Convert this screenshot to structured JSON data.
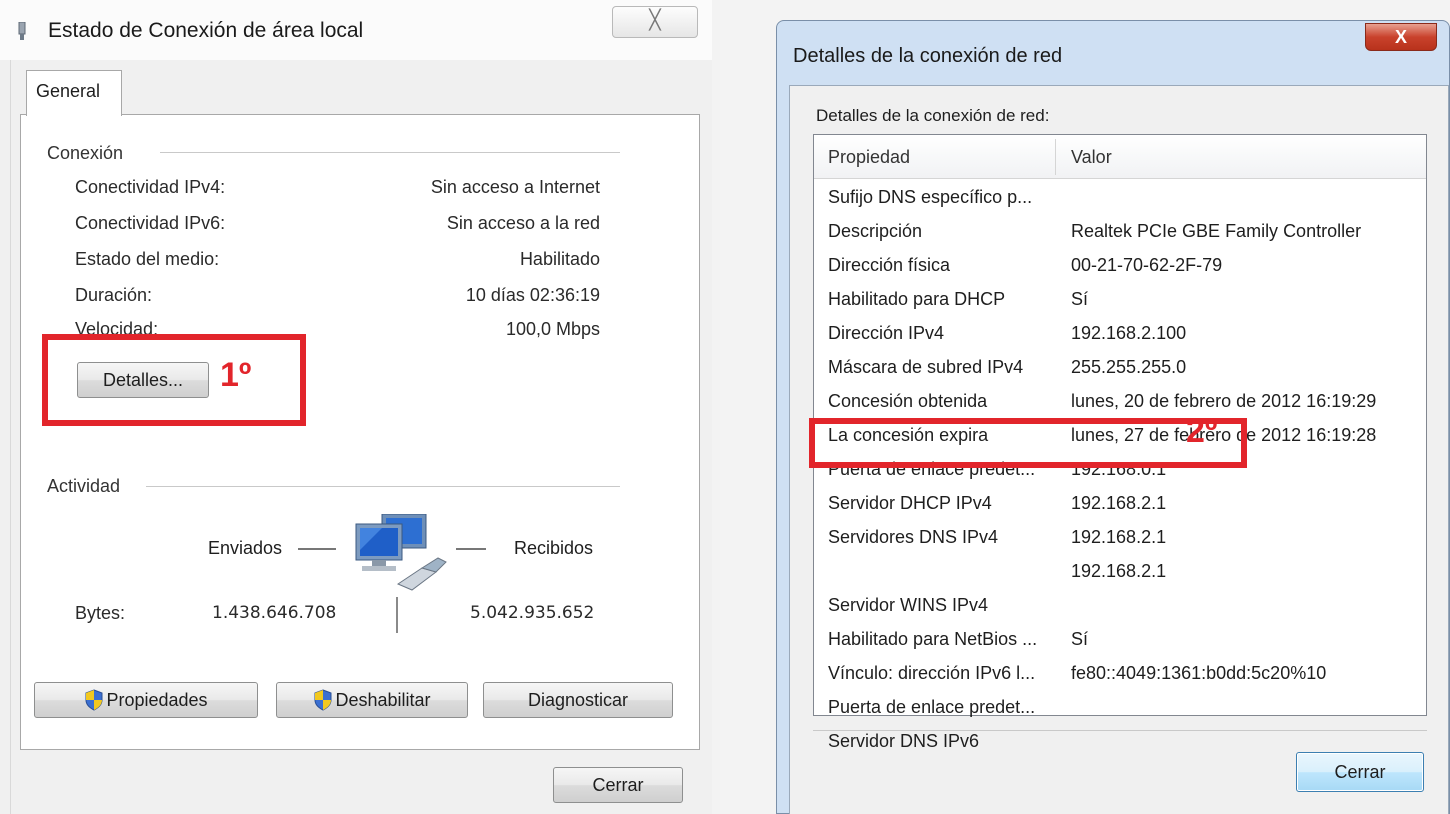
{
  "left_window": {
    "title": "Estado de Conexión de área local",
    "close_glyph": "╳",
    "tab": "General",
    "connection": {
      "group": "Conexión",
      "rows": [
        {
          "label": "Conectividad IPv4:",
          "value": "Sin acceso a Internet"
        },
        {
          "label": "Conectividad IPv6:",
          "value": "Sin acceso a la red"
        },
        {
          "label": "Estado del medio:",
          "value": "Habilitado"
        },
        {
          "label": "Duración:",
          "value": "10 días 02:36:19"
        },
        {
          "label": "Velocidad:",
          "value": "100,0 Mbps"
        }
      ],
      "details_button": "Detalles...",
      "mark": "1º"
    },
    "activity": {
      "group": "Actividad",
      "sent_label": "Enviados",
      "received_label": "Recibidos",
      "bytes_label": "Bytes:",
      "bytes_sent": "1.438.646.708",
      "bytes_received": "5.042.935.652"
    },
    "buttons": {
      "properties": "Propiedades",
      "disable": "Deshabilitar",
      "diagnose": "Diagnosticar",
      "close": "Cerrar"
    }
  },
  "right_window": {
    "title": "Detalles de la conexión de red",
    "close_glyph": "X",
    "caption": "Detalles de la conexión de red:",
    "columns": {
      "property": "Propiedad",
      "value": "Valor"
    },
    "rows": [
      {
        "property": "Sufijo DNS específico p...",
        "value": ""
      },
      {
        "property": "Descripción",
        "value": "Realtek PCIe GBE Family Controller"
      },
      {
        "property": "Dirección física",
        "value": "00-21-70-62-2F-79"
      },
      {
        "property": "Habilitado para DHCP",
        "value": "Sí"
      },
      {
        "property": "Dirección IPv4",
        "value": "192.168.2.100"
      },
      {
        "property": "Máscara de subred IPv4",
        "value": "255.255.255.0"
      },
      {
        "property": "Concesión obtenida",
        "value": "lunes, 20 de febrero de 2012 16:19:29"
      },
      {
        "property": "La concesión expira",
        "value": "lunes, 27 de febrero de 2012 16:19:28"
      },
      {
        "property": "Puerta de enlace predet...",
        "value": "192.168.0.1"
      },
      {
        "property": "Servidor DHCP IPv4",
        "value": "192.168.2.1"
      },
      {
        "property": "Servidores DNS IPv4",
        "value": "192.168.2.1"
      },
      {
        "property": "",
        "value": "192.168.2.1"
      },
      {
        "property": "Servidor WINS IPv4",
        "value": ""
      },
      {
        "property": "Habilitado para NetBios ...",
        "value": "Sí"
      },
      {
        "property": "Vínculo: dirección IPv6 l...",
        "value": "fe80::4049:1361:b0dd:5c20%10"
      },
      {
        "property": "Puerta de enlace predet...",
        "value": ""
      },
      {
        "property": "Servidor DNS IPv6",
        "value": ""
      }
    ],
    "mark": "2º",
    "close_button": "Cerrar"
  },
  "colors": {
    "annotation_red": "#e2252b",
    "aero_frame": "#cfe0f3",
    "close_red": "#c9422c"
  }
}
